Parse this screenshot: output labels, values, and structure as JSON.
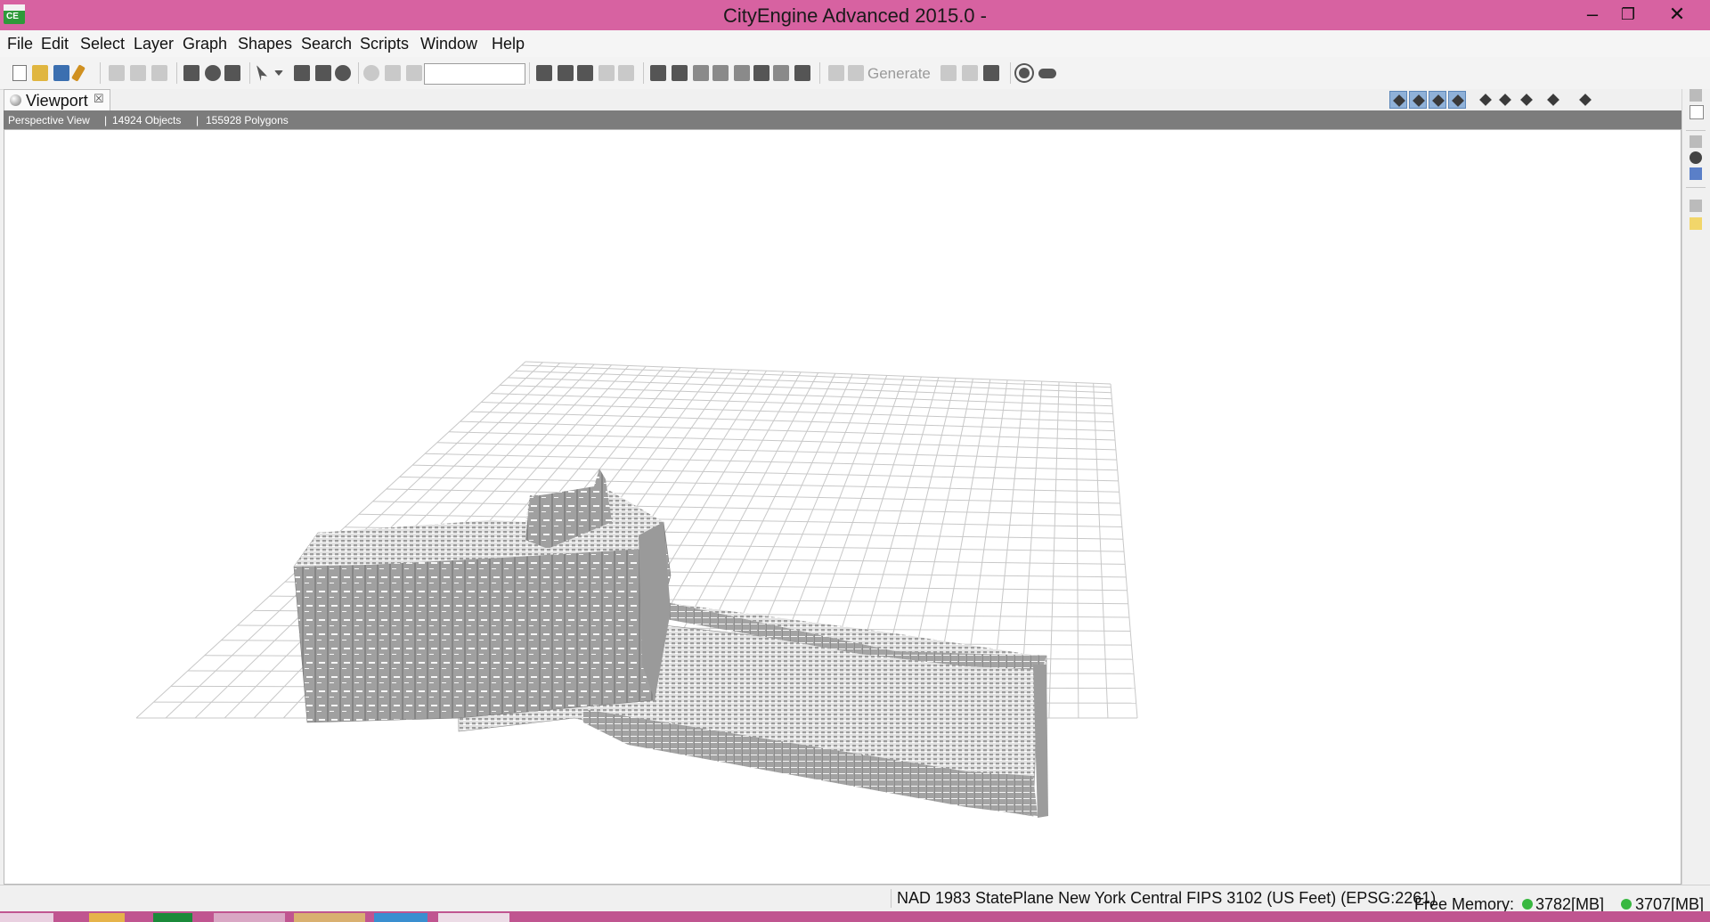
{
  "window": {
    "title": "CityEngine Advanced 2015.0 -",
    "app_icon_text": "CE",
    "minimize_glyph": "–",
    "restore_glyph": "❐",
    "close_glyph": "✕",
    "accent_color": "#d762a1"
  },
  "menu": [
    "File",
    "Edit",
    "Select",
    "Layer",
    "Graph",
    "Shapes",
    "Search",
    "Scripts",
    "Window",
    "Help"
  ],
  "toolbar": {
    "search_value": "",
    "generate_label": "Generate"
  },
  "viewport": {
    "tab_label": "Viewport",
    "tab_close_glyph": "☒",
    "view_name": "Perspective View",
    "objects": "14924 Objects",
    "polygons": "155928 Polygons",
    "background_color": "#ffffff",
    "grid_color": "#c8c8c8",
    "model_color": "#9e9e9e"
  },
  "statusbar": {
    "crs": "NAD 1983 StatePlane New York Central FIPS 3102 (US Feet) (EPSG:2261)",
    "free_memory_label": "Free Memory:",
    "memory_1": "3782[MB]",
    "memory_2": "3707[MB]"
  },
  "icons": [
    "new-icon",
    "open-icon",
    "save-icon",
    "tool-icon",
    "cut-icon",
    "copy-icon",
    "paste-icon",
    "move-icon",
    "rotate-icon",
    "scale-icon",
    "select-icon",
    "generate-icon",
    "sun-icon",
    "cloud-icon",
    "sphere-icon",
    "info-icon"
  ]
}
